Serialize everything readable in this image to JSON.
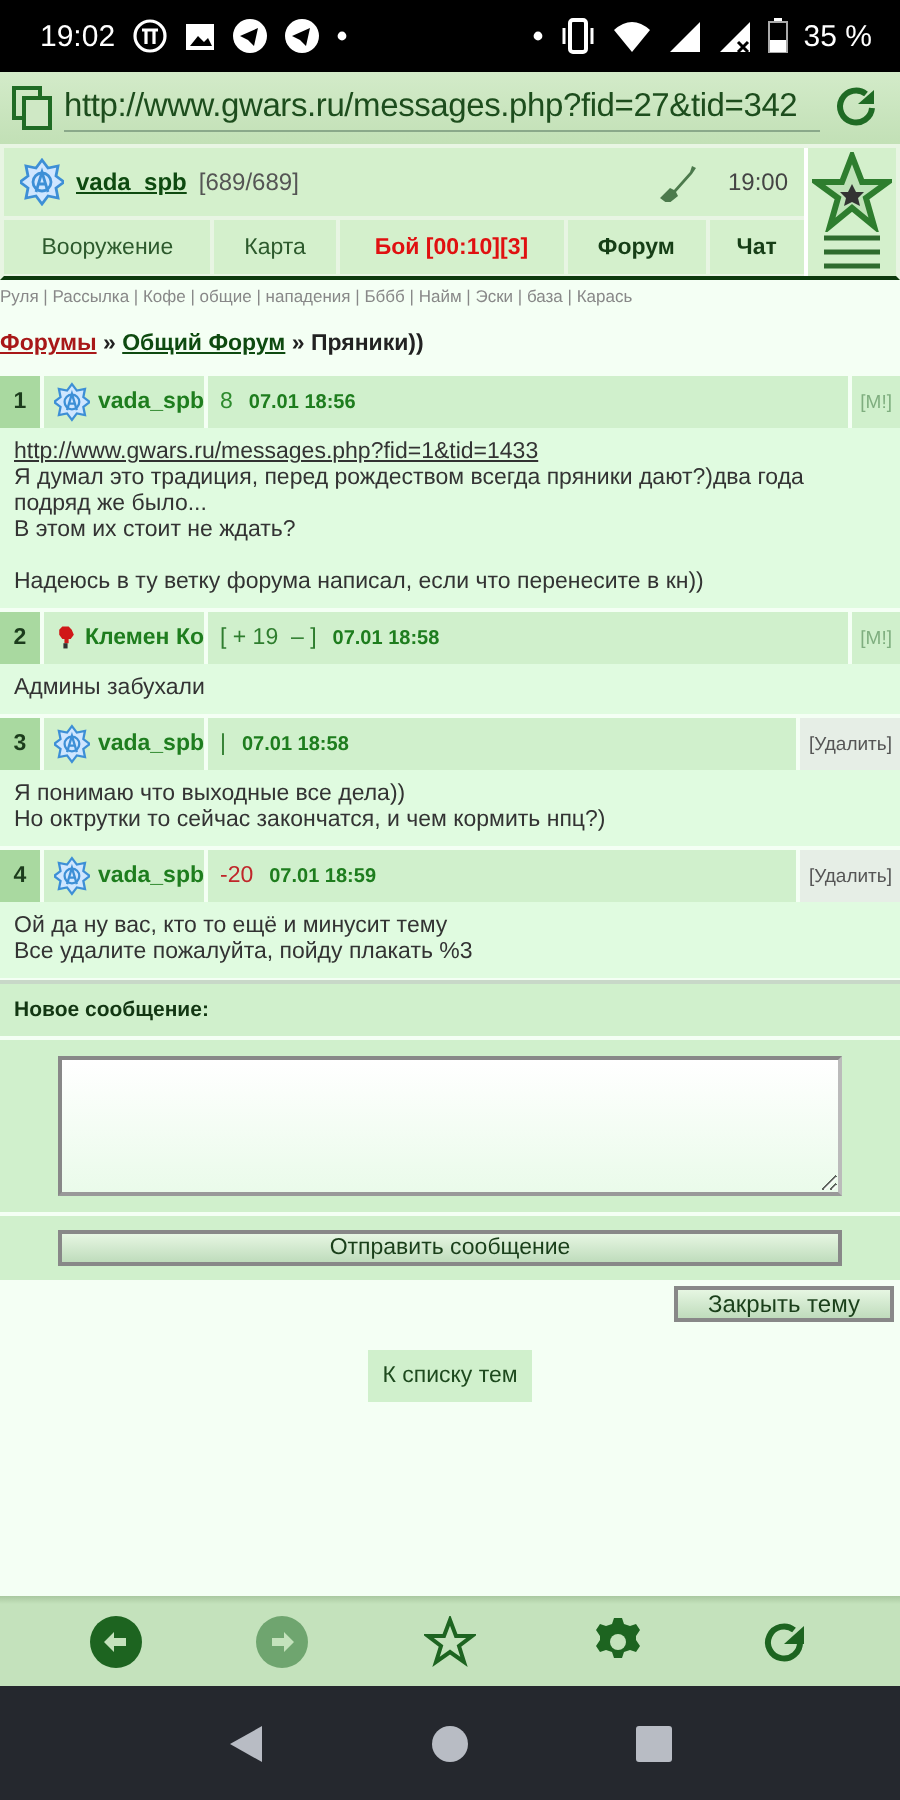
{
  "status_bar": {
    "time": "19:02",
    "battery": "35 %"
  },
  "browser": {
    "url": "http://www.gwars.ru/messages.php?fid=27&tid=342"
  },
  "header": {
    "user": "vada_spb",
    "hp": "[689/689]",
    "time": "19:00"
  },
  "nav_tabs": [
    {
      "label": "Вооружение",
      "kind": "plain"
    },
    {
      "label": "Карта",
      "kind": "plain"
    },
    {
      "label": "Бой [00:10][3]",
      "kind": "alert"
    },
    {
      "label": "Форум",
      "kind": "strong"
    },
    {
      "label": "Чат",
      "kind": "strong"
    }
  ],
  "quick_links": "Руля | Рассылка | Кофе | общие | нападения | Бббб | Найм | Эски | база | Карась",
  "breadcrumb": [
    {
      "label": "Форумы",
      "kind": "root"
    },
    {
      "label": "»",
      "kind": "separator"
    },
    {
      "label": "Общий Форум",
      "kind": "link"
    },
    {
      "label": "»",
      "kind": "separator"
    },
    {
      "label": "Пряники))",
      "kind": "current"
    }
  ],
  "posts": [
    {
      "number": "1",
      "author": "vada_spb",
      "kind": "anarchy",
      "rating": {
        "text": "8",
        "kind": "positive"
      },
      "date": "07.01 18:56",
      "action": {
        "label": "[M!]",
        "kind": "faded"
      },
      "body": [
        {
          "kind": "link",
          "text": "http://www.gwars.ru/messages.php?fid=1&tid=1433"
        },
        {
          "kind": "text",
          "text": "Я думал это традиция, перед рождеством всегда пряники дают?)два года подряд же было..."
        },
        {
          "kind": "text",
          "text": "В этом их стоит не ждать?"
        },
        {
          "kind": "spaced",
          "text": "Надеюсь в ту ветку форума написал, если что перенесите в кн))"
        }
      ]
    },
    {
      "number": "2",
      "author": "Клемен Ко",
      "kind": "emblem",
      "rating": {
        "text": "[ + 19  – ]",
        "kind": "vote"
      },
      "date": "07.01 18:58",
      "action": {
        "label": "[M!]",
        "kind": "faded"
      },
      "body": [
        {
          "kind": "text",
          "text": "Админы забухали"
        }
      ]
    },
    {
      "number": "3",
      "author": "vada_spb",
      "kind": "anarchy",
      "rating": {
        "text": "|",
        "kind": "neutral"
      },
      "date": "07.01 18:58",
      "action": {
        "label": "[Удалить]",
        "kind": "delete"
      },
      "body": [
        {
          "kind": "text",
          "text": "Я понимаю что выходные все дела))"
        },
        {
          "kind": "text",
          "text": "Но октрутки то сейчас закончатся, и чем кормить нпц?)"
        }
      ]
    },
    {
      "number": "4",
      "author": "vada_spb",
      "kind": "anarchy",
      "rating": {
        "text": "-20",
        "kind": "negative"
      },
      "date": "07.01 18:59",
      "action": {
        "label": "[Удалить]",
        "kind": "delete"
      },
      "body": [
        {
          "kind": "text",
          "text": "Ой да ну вас, кто то ещё и минусит тему"
        },
        {
          "kind": "text",
          "text": "Все удалите пожалуйта, пойду плакать %3"
        }
      ]
    }
  ],
  "reply_form": {
    "title": "Новое сообщение:",
    "send_button": "Отправить сообщение"
  },
  "close_topic_button": "Закрыть тему",
  "topic_list_link": "К списку тем",
  "toolbar": [
    {
      "kind": "back",
      "disabled": false
    },
    {
      "kind": "forward",
      "disabled": true
    },
    {
      "kind": "star",
      "disabled": false
    },
    {
      "kind": "settings",
      "disabled": false
    },
    {
      "kind": "reload",
      "disabled": false
    }
  ]
}
